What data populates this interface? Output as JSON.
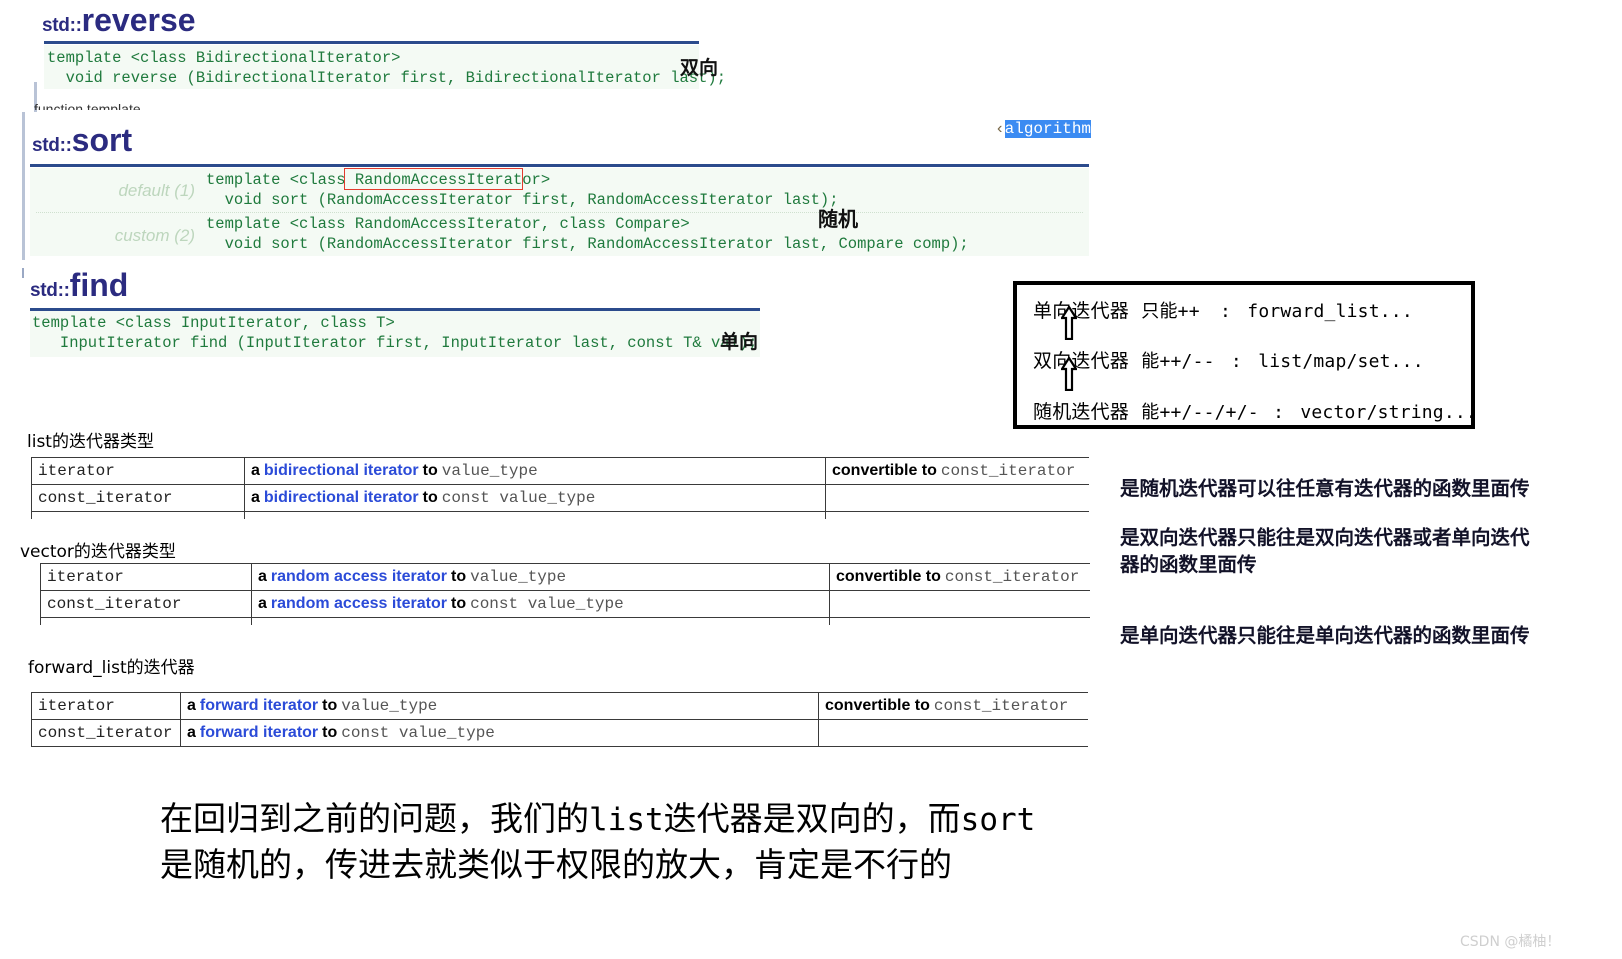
{
  "reverse": {
    "ns": "std::",
    "fn": "reverse",
    "proto_line1": "template <class BidirectionalIterator>",
    "proto_line2": "  void reverse (BidirectionalIterator first, BidirectionalIterator last);",
    "annotation": "双向"
  },
  "clipped_top_text": "function template",
  "sort": {
    "ns": "std::",
    "fn": "sort",
    "header_tag_bracket": "‹",
    "header_tag_text": "algorithm",
    "variants": [
      {
        "label": "default (1)",
        "line1_pre": "template <class ",
        "line1_boxed": "RandomAccessIterator",
        "line1_post": ">",
        "line2": "  void sort (RandomAccessIterator first, RandomAccessIterator last);"
      },
      {
        "label": "custom (2)",
        "line1": "template <class RandomAccessIterator, class Compare>",
        "line2": "  void sort (RandomAccessIterator first, RandomAccessIterator last, Compare comp);"
      }
    ],
    "annotation": "随机"
  },
  "find": {
    "ns": "std::",
    "fn": "find",
    "proto_line1": "template <class InputIterator, class T>",
    "proto_line2": "   InputIterator find (InputIterator first, InputIterator last, const T& val);",
    "annotation": "单向"
  },
  "iterator_box": {
    "rows": [
      {
        "name": "单向迭代器",
        "ops": "只能++",
        "colon": ":",
        "containers": "forward_list..."
      },
      {
        "name": "双向迭代器",
        "ops": "能++/--",
        "colon": ":",
        "containers": "list/map/set..."
      },
      {
        "name": "随机迭代器",
        "ops": "能++/--/+/-",
        "colon": ":",
        "containers": "vector/string..."
      }
    ],
    "arrows": [
      "up-arrow-icon",
      "up-arrow-icon"
    ]
  },
  "tables": [
    {
      "caption": "list的迭代器类型",
      "rows": [
        {
          "c1": "iterator",
          "a": "a",
          "link": "bidirectional iterator",
          "to": "to",
          "type": "value_type",
          "c3_bold": "convertible to",
          "c3_mono": "const_iterator"
        },
        {
          "c1": "const_iterator",
          "a": "a",
          "link": "bidirectional iterator",
          "to": "to",
          "type": "const value_type",
          "c3_bold": "",
          "c3_mono": ""
        }
      ]
    },
    {
      "caption": "vector的迭代器类型",
      "rows": [
        {
          "c1": "iterator",
          "a": "a",
          "link": "random access iterator",
          "to": "to",
          "type": "value_type",
          "c3_bold": "convertible to",
          "c3_mono": "const_iterator"
        },
        {
          "c1": "const_iterator",
          "a": "a",
          "link": "random access iterator",
          "to": "to",
          "type": "const value_type",
          "c3_bold": "",
          "c3_mono": ""
        }
      ]
    },
    {
      "caption": "forward_list的迭代器",
      "rows": [
        {
          "c1": "iterator",
          "a": "a",
          "link": "forward iterator",
          "to": "to",
          "type": "value_type",
          "c3_bold": "convertible to",
          "c3_mono": "const_iterator"
        },
        {
          "c1": "const_iterator",
          "a": "a",
          "link": "forward iterator",
          "to": "to",
          "type": "const value_type",
          "c3_bold": "",
          "c3_mono": ""
        }
      ]
    }
  ],
  "notes": [
    "是随机迭代器可以往任意有迭代器的函数里面传",
    "是双向迭代器只能往是双向迭代器或者单向迭代\n器的函数里面传",
    "是单向迭代器只能往是单向迭代器的函数里面传"
  ],
  "note_lines": {
    "n1": "是随机迭代器可以往任意有迭代器的函数里面传",
    "n2a": "是双向迭代器只能往是双向迭代器或者单向迭代",
    "n2b": "器的函数里面传",
    "n3": "是单向迭代器只能往是单向迭代器的函数里面传"
  },
  "caption": {
    "line1_a": "在回归到之前的问题，我们的",
    "line1_mono1": "list",
    "line1_b": "迭代器是双向的，而",
    "line1_mono2": "sort",
    "line2": "是随机的，传进去就类似于权限的放大，肯定是不行的"
  },
  "watermark": "CSDN @橘柚！",
  "colors": {
    "title": "#2b2b80",
    "rule": "#2b4b8c",
    "code": "#1f7a3d",
    "link": "#2b4bd8",
    "selection": "#3b8bf2",
    "redbox": "#e23b2e",
    "variant": "#bdd6bd"
  }
}
